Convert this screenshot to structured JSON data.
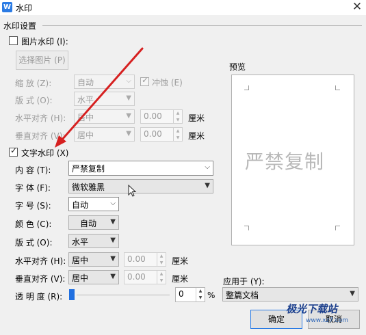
{
  "window": {
    "title": "水印",
    "app_icon": "W",
    "close_glyph": "✕"
  },
  "section_title": "水印设置",
  "picture_watermark": {
    "label": "图片水印 (I):",
    "checked": false,
    "choose_button": "选择图片 (P)",
    "scale": {
      "label": "缩 放 (Z):",
      "value": "自动"
    },
    "washout": {
      "label": "冲蚀 (E)",
      "checked": true
    },
    "layout": {
      "label": "版 式 (O):",
      "value": "水平"
    },
    "h_align": {
      "label": "水平对齐 (H):",
      "value": "居中",
      "offset": "0.00",
      "unit": "厘米"
    },
    "v_align": {
      "label": "垂直对齐 (V):",
      "value": "居中",
      "offset": "0.00",
      "unit": "厘米"
    }
  },
  "text_watermark": {
    "label": "文字水印 (X)",
    "checked": true,
    "content": {
      "label": "内 容 (T):",
      "value": "严禁复制"
    },
    "font": {
      "label": "字 体 (F):",
      "value": "微软雅黑"
    },
    "size": {
      "label": "字 号 (S):",
      "value": "自动"
    },
    "color": {
      "label": "颜 色 (C):",
      "value": "自动"
    },
    "layout": {
      "label": "版 式 (O):",
      "value": "水平"
    },
    "h_align": {
      "label": "水平对齐 (H):",
      "value": "居中",
      "offset": "0.00",
      "unit": "厘米"
    },
    "v_align": {
      "label": "垂直对齐 (V):",
      "value": "居中",
      "offset": "0.00",
      "unit": "厘米"
    },
    "transparency": {
      "label": "透 明 度 (R):",
      "value": "0",
      "unit": "%",
      "level_percent": 0
    }
  },
  "preview": {
    "label": "预览",
    "watermark_text": "严禁复制"
  },
  "apply_to": {
    "label": "应用于 (Y):",
    "value": "整篇文档"
  },
  "buttons": {
    "ok": "确定",
    "cancel": "取消"
  },
  "brand": {
    "name": "极光下载站",
    "url": "www.xz7.com"
  },
  "colors": {
    "accent": "#1f6fe0",
    "arrow": "#d62020"
  }
}
